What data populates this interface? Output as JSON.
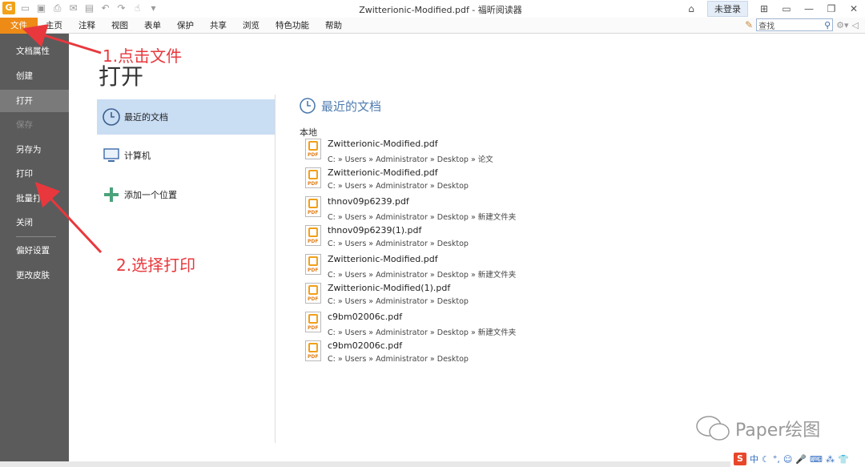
{
  "window": {
    "title": "Zwitterionic-Modified.pdf - 福昕阅读器",
    "login_label": "未登录",
    "icons": [
      "app-logo-icon",
      "open-icon",
      "save-icon",
      "print-icon",
      "email-icon",
      "clipboard-icon",
      "undo-icon",
      "redo-icon",
      "hand-icon",
      "dropdown-icon"
    ]
  },
  "menu": {
    "file": "文件",
    "items": [
      "主页",
      "注释",
      "视图",
      "表单",
      "保护",
      "共享",
      "浏览",
      "特色功能",
      "帮助"
    ],
    "search_placeholder": "查找"
  },
  "sidebar": {
    "items": [
      {
        "label": "文档属性",
        "state": "normal"
      },
      {
        "label": "创建",
        "state": "normal"
      },
      {
        "label": "打开",
        "state": "active"
      },
      {
        "label": "保存",
        "state": "disabled"
      },
      {
        "label": "另存为",
        "state": "normal"
      },
      {
        "label": "打印",
        "state": "normal"
      },
      {
        "label": "批量打印",
        "state": "normal"
      },
      {
        "label": "关闭",
        "state": "normal"
      },
      {
        "label": "偏好设置",
        "state": "normal"
      },
      {
        "label": "更改皮肤",
        "state": "normal"
      }
    ]
  },
  "main": {
    "title": "打开",
    "options": [
      {
        "label": "最近的文档",
        "icon": "clock-icon",
        "selected": true
      },
      {
        "label": "计算机",
        "icon": "computer-icon",
        "selected": false
      },
      {
        "label": "添加一个位置",
        "icon": "plus-icon",
        "selected": false
      }
    ],
    "recent": {
      "title": "最近的文档",
      "section": "本地",
      "files": [
        {
          "name": "Zwitterionic-Modified.pdf",
          "path": "C: » Users » Administrator » Desktop » 论文"
        },
        {
          "name": "Zwitterionic-Modified.pdf",
          "path": "C: » Users » Administrator » Desktop"
        },
        {
          "name": "thnov09p6239.pdf",
          "path": "C: » Users » Administrator » Desktop » 新建文件夹"
        },
        {
          "name": "thnov09p6239(1).pdf",
          "path": "C: » Users » Administrator » Desktop"
        },
        {
          "name": "Zwitterionic-Modified.pdf",
          "path": "C: » Users » Administrator » Desktop » 新建文件夹"
        },
        {
          "name": "Zwitterionic-Modified(1).pdf",
          "path": "C: » Users » Administrator » Desktop"
        },
        {
          "name": "c9bm02006c.pdf",
          "path": "C: » Users » Administrator » Desktop » 新建文件夹"
        },
        {
          "name": "c9bm02006c.pdf",
          "path": "C: » Users » Administrator » Desktop"
        }
      ]
    }
  },
  "annotations": {
    "step1": "1.点击文件",
    "step2": "2.选择打印",
    "color": "#e8383d"
  },
  "watermark": "Paper绘图",
  "ime": {
    "logo": "S",
    "lang": "中"
  }
}
